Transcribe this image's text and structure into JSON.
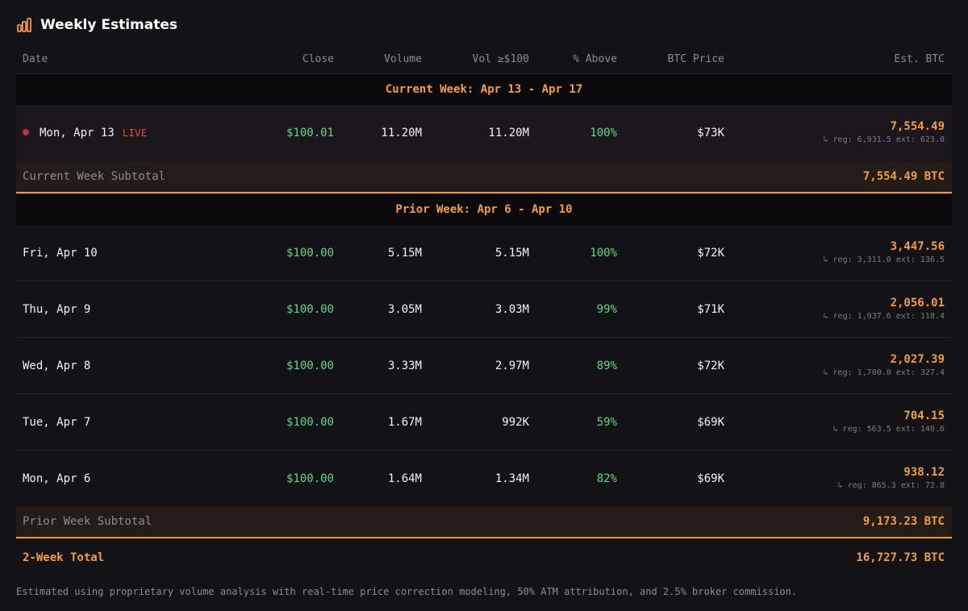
{
  "header": {
    "title": "Weekly Estimates",
    "icon": "bar-chart-icon"
  },
  "columns": {
    "date": "Date",
    "close": "Close",
    "volume": "Volume",
    "vol_100": "Vol ≥$100",
    "pct_above": "% Above",
    "btc_price": "BTC Price",
    "est_btc": "Est. BTC"
  },
  "current_week": {
    "title": "Current Week: Apr 13 - Apr 17",
    "rows": [
      {
        "date": "Mon, Apr 13",
        "live": "LIVE",
        "close": "$100.01",
        "volume": "11.20M",
        "vol_100": "11.20M",
        "pct_above": "100%",
        "btc_price": "$73K",
        "est_btc": "7,554.49",
        "breakdown": "↳ reg: 6,931.5 ext: 623.0"
      }
    ],
    "subtotal_label": "Current Week Subtotal",
    "subtotal_value": "7,554.49 BTC"
  },
  "prior_week": {
    "title": "Prior Week: Apr 6 - Apr 10",
    "rows": [
      {
        "date": "Fri, Apr 10",
        "close": "$100.00",
        "volume": "5.15M",
        "vol_100": "5.15M",
        "pct_above": "100%",
        "btc_price": "$72K",
        "est_btc": "3,447.56",
        "breakdown": "↳ reg: 3,311.0 ext: 136.5"
      },
      {
        "date": "Thu, Apr 9",
        "close": "$100.00",
        "volume": "3.05M",
        "vol_100": "3.03M",
        "pct_above": "99%",
        "btc_price": "$71K",
        "est_btc": "2,056.01",
        "breakdown": "↳ reg: 1,937.6 ext: 118.4"
      },
      {
        "date": "Wed, Apr 8",
        "close": "$100.00",
        "volume": "3.33M",
        "vol_100": "2.97M",
        "pct_above": "89%",
        "btc_price": "$72K",
        "est_btc": "2,027.39",
        "breakdown": "↳ reg: 1,700.0 ext: 327.4"
      },
      {
        "date": "Tue, Apr 7",
        "close": "$100.00",
        "volume": "1.67M",
        "vol_100": "992K",
        "pct_above": "59%",
        "btc_price": "$69K",
        "est_btc": "704.15",
        "breakdown": "↳ reg: 563.5 ext: 140.6"
      },
      {
        "date": "Mon, Apr 6",
        "close": "$100.00",
        "volume": "1.64M",
        "vol_100": "1.34M",
        "pct_above": "82%",
        "btc_price": "$69K",
        "est_btc": "938.12",
        "breakdown": "↳ reg: 865.3 ext: 72.8"
      }
    ],
    "subtotal_label": "Prior Week Subtotal",
    "subtotal_value": "9,173.23 BTC"
  },
  "total": {
    "label": "2-Week Total",
    "value": "16,727.73 BTC"
  },
  "footnote": "Estimated using proprietary volume analysis with real-time price correction modeling, 50% ATM attribution, and 2.5% broker commission.",
  "colors": {
    "background": "#131217",
    "accent": "#f39c44",
    "positive": "#5bd98a",
    "live": "#ef4a45"
  }
}
